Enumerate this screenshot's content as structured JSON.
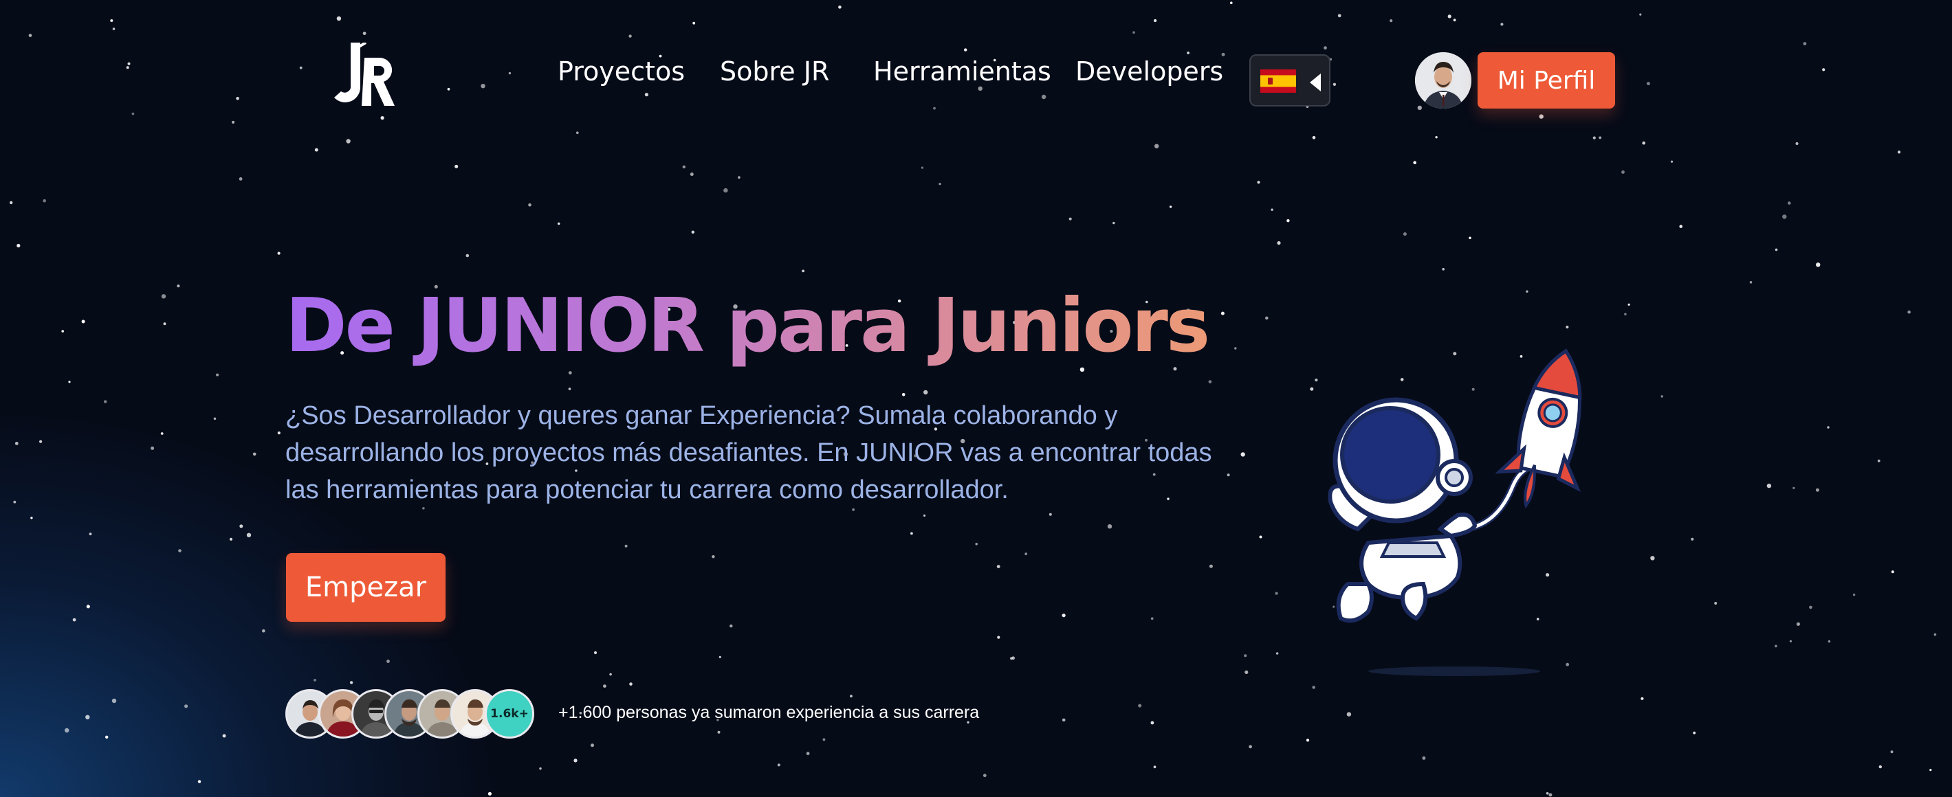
{
  "nav": {
    "logo_text": "JR",
    "links": [
      "Proyectos",
      "Sobre JR",
      "Herramientas",
      "Developers"
    ],
    "language_flag": "spain-flag",
    "profile_button": "Mi Perfil"
  },
  "hero": {
    "title": "De JUNIOR para Juniors",
    "description": "¿Sos Desarrollador y queres ganar Experiencia? Sumala colaborando y desarrollando los proyectos más desafiantes. En JUNIOR vas a encontrar todas las herramientas para potenciar tu carrera como desarrollador.",
    "cta": "Empezar"
  },
  "social_proof": {
    "count_badge": "1.6k+",
    "text": "+1.600 personas ya sumaron experiencia a sus carrera"
  },
  "colors": {
    "accent": "#ee5a37",
    "background": "#060b18",
    "description_text": "#9cb3e6",
    "title_gradient": [
      "#a66af0",
      "#ec9a76"
    ]
  }
}
